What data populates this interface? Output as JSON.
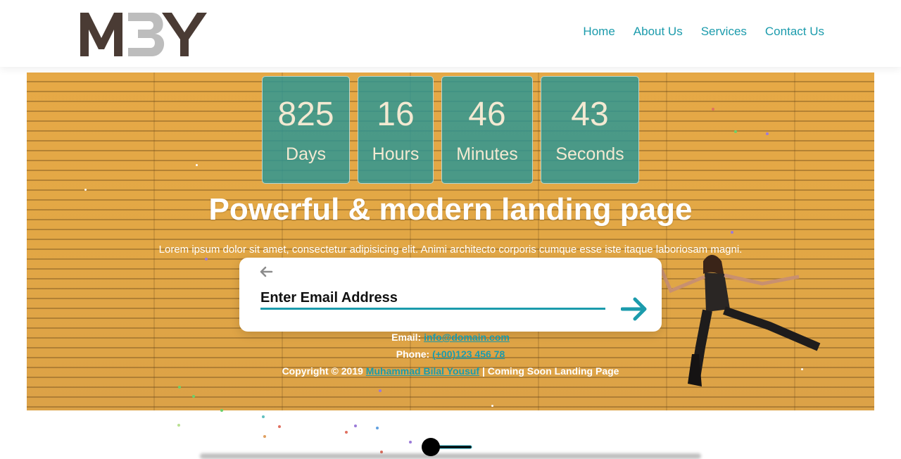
{
  "logo": {
    "text": "MBY",
    "letters": [
      "M",
      "B",
      "Y"
    ]
  },
  "nav": {
    "items": [
      {
        "label": "Home"
      },
      {
        "label": "About Us"
      },
      {
        "label": "Services"
      },
      {
        "label": "Contact Us"
      }
    ]
  },
  "countdown": [
    {
      "value": "825",
      "label": "Days"
    },
    {
      "value": "16",
      "label": "Hours"
    },
    {
      "value": "46",
      "label": "Minutes"
    },
    {
      "value": "43",
      "label": "Seconds"
    }
  ],
  "hero": {
    "headline": "Powerful & modern landing page",
    "subtext": "Lorem ipsum dolor sit amet, consectetur adipisicing elit. Animi architecto corporis cumque esse iste itaque laboriosam magni."
  },
  "subscribe": {
    "placeholder": "Enter Email Address"
  },
  "contact": {
    "email_label": "Email:",
    "email_value": "info@domain.com",
    "phone_label": "Phone:",
    "phone_value": "(+00)123 456 78",
    "copyright_prefix": "Copyright © 2019",
    "author": "Muhammad Bilal Yousuf",
    "copyright_suffix": "| Coming Soon Landing Page"
  },
  "colors": {
    "accent": "#1b9bac",
    "wall": "#e2a745",
    "countdown_bg": "#2a9a96"
  }
}
